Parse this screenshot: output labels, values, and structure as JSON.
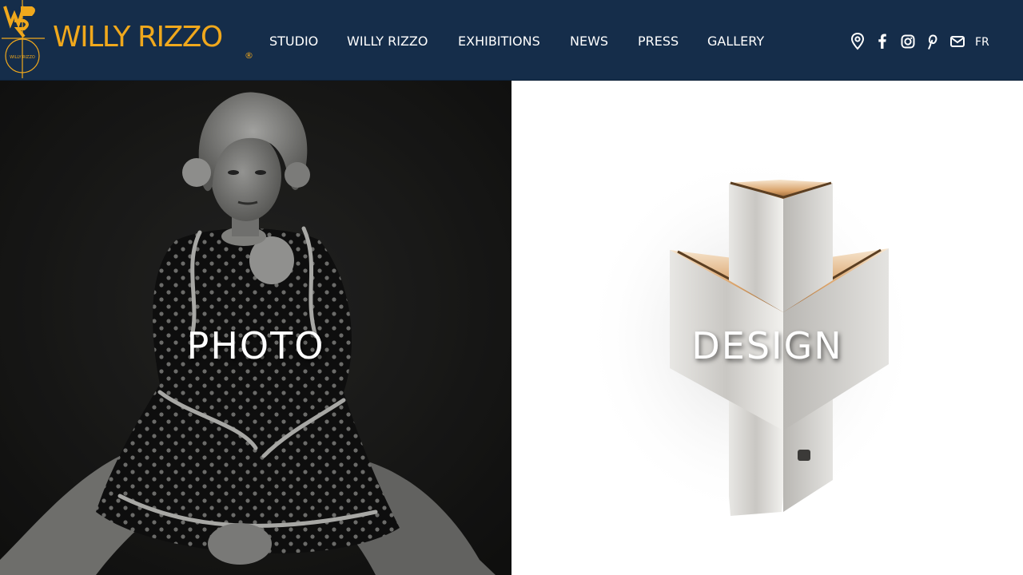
{
  "brand": {
    "name": "WILLY RIZZO",
    "registered_mark": "®",
    "monogram_caption": "WILLY RIZZO",
    "accent_color": "#f0a81c",
    "header_color": "#152d4a"
  },
  "nav": {
    "items": [
      {
        "label": "STUDIO"
      },
      {
        "label": "WILLY RIZZO"
      },
      {
        "label": "EXHIBITIONS"
      },
      {
        "label": "NEWS"
      },
      {
        "label": "PRESS"
      },
      {
        "label": "GALLERY"
      }
    ]
  },
  "social": {
    "icons": [
      "map-pin-icon",
      "facebook-icon",
      "instagram-icon",
      "pinterest-icon",
      "mail-icon"
    ],
    "language": "FR"
  },
  "panels": [
    {
      "title": "PHOTO",
      "image": "black-and-white portrait"
    },
    {
      "title": "DESIGN",
      "image": "chrome triangular lamp"
    }
  ]
}
